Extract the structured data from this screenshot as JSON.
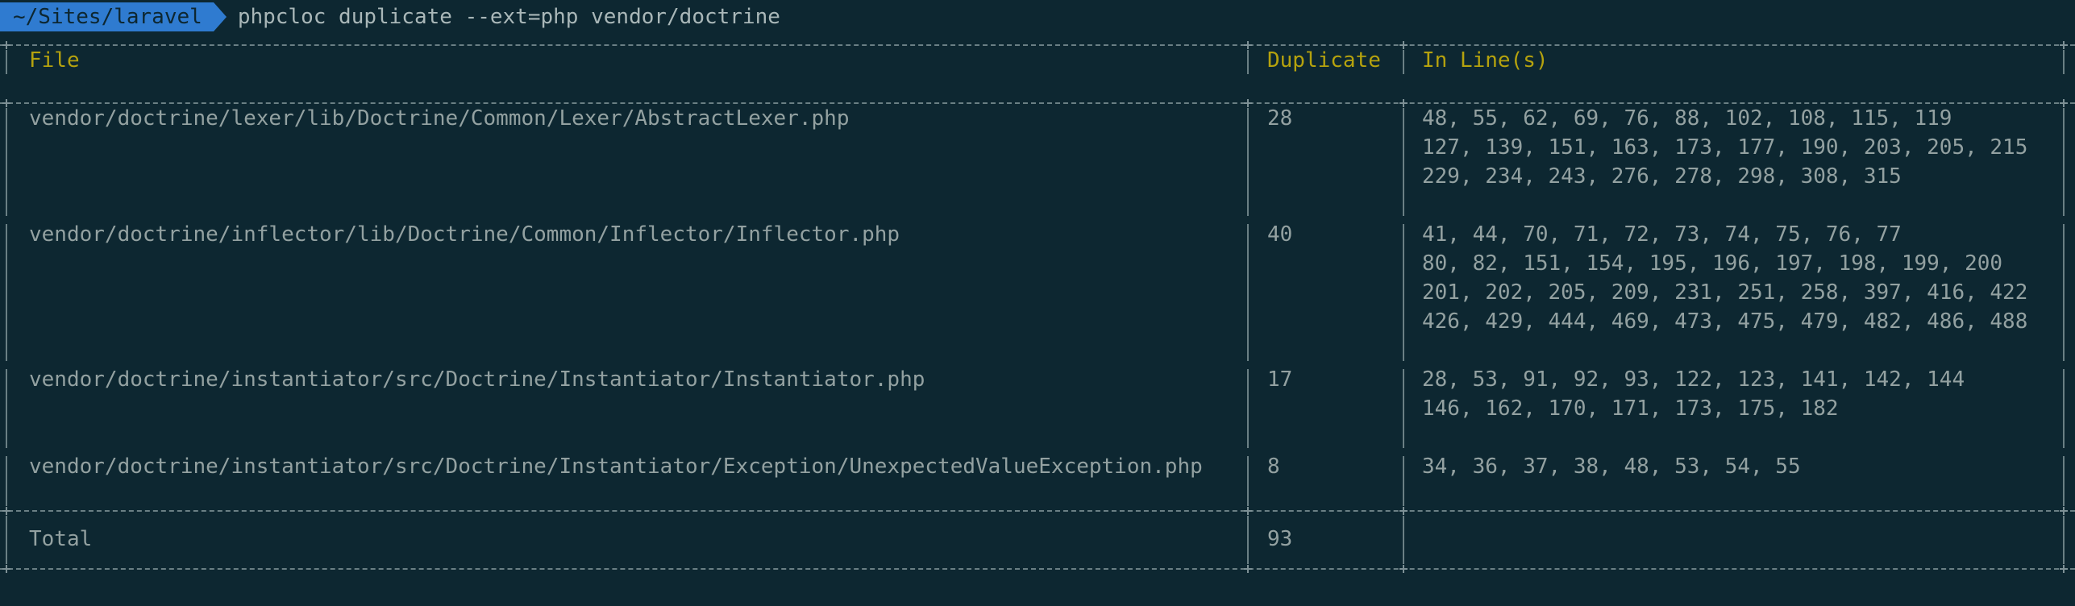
{
  "prompt": {
    "path": "~/Sites/laravel",
    "command": "phpcloc duplicate --ext=php vendor/doctrine"
  },
  "table": {
    "headers": [
      "File",
      "Duplicate",
      "In Line(s)"
    ],
    "rows": [
      {
        "file": "vendor/doctrine/lexer/lib/Doctrine/Common/Lexer/AbstractLexer.php",
        "duplicate": "28",
        "lines": [
          "48, 55, 62, 69, 76, 88, 102, 108, 115, 119",
          "127, 139, 151, 163, 173, 177, 190, 203, 205, 215",
          "229, 234, 243, 276, 278, 298, 308, 315"
        ]
      },
      {
        "file": "vendor/doctrine/inflector/lib/Doctrine/Common/Inflector/Inflector.php",
        "duplicate": "40",
        "lines": [
          "41, 44, 70, 71, 72, 73, 74, 75, 76, 77",
          "80, 82, 151, 154, 195, 196, 197, 198, 199, 200",
          "201, 202, 205, 209, 231, 251, 258, 397, 416, 422",
          "426, 429, 444, 469, 473, 475, 479, 482, 486, 488"
        ]
      },
      {
        "file": "vendor/doctrine/instantiator/src/Doctrine/Instantiator/Instantiator.php",
        "duplicate": "17",
        "lines": [
          "28, 53, 91, 92, 93, 122, 123, 141, 142, 144",
          "146, 162, 170, 171, 173, 175, 182"
        ]
      },
      {
        "file": "vendor/doctrine/instantiator/src/Doctrine/Instantiator/Exception/UnexpectedValueException.php",
        "duplicate": "8",
        "lines": [
          "34, 36, 37, 38, 48, 53, 54, 55"
        ]
      }
    ],
    "total": {
      "label": "Total",
      "value": "93"
    }
  },
  "colors": {
    "background": "#0d2731",
    "text": "#93a1a1",
    "header": "#b5a20e",
    "prompt_bg": "#2f7bd0"
  }
}
